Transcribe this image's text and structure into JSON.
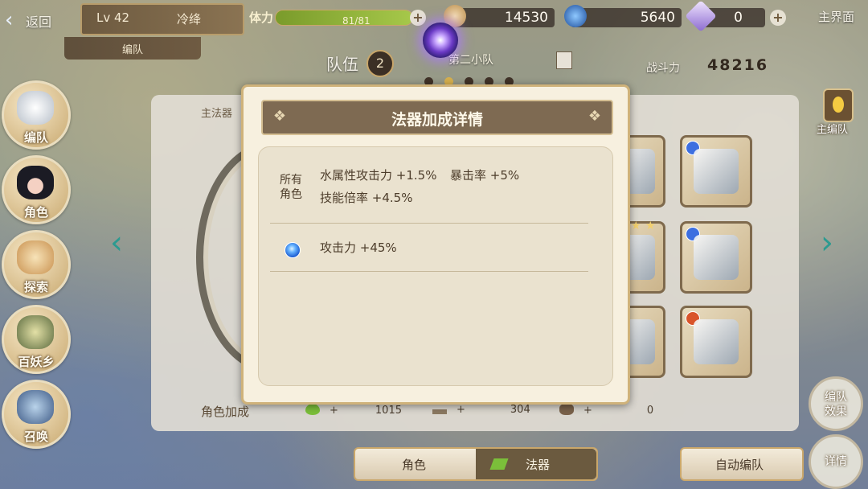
{
  "topbar": {
    "back_label": "返回",
    "level": "Lv 42",
    "player_name": "冷绛",
    "team_label": "编队",
    "stamina_label": "体力",
    "stamina_value": "81/81",
    "stamina_fraction": 1.0,
    "currency1": "14530",
    "currency2": "5640",
    "currency3": "0",
    "main_screen_label": "主界面"
  },
  "formation": {
    "label": "队伍",
    "number": "2",
    "squad_name": "第二小队",
    "page_count": 5,
    "active_page": 1
  },
  "power": {
    "label": "战斗力",
    "value": "48216"
  },
  "leftnav": [
    {
      "label": "编队",
      "icon": "team-icon"
    },
    {
      "label": "角色",
      "icon": "character-icon"
    },
    {
      "label": "探索",
      "icon": "explore-icon"
    },
    {
      "label": "百妖乡",
      "icon": "village-icon"
    },
    {
      "label": "召唤",
      "icon": "summon-icon"
    }
  ],
  "main": {
    "main_artifact_tag": "主法器",
    "role_bonus_label": "角色加成",
    "stat_hp": "1015",
    "stat_atk": "304",
    "stat_spd": "0",
    "stat_plus": "+"
  },
  "bottom": {
    "tab_character": "角色",
    "tab_artifact": "法器",
    "auto_team": "自动编队"
  },
  "right": {
    "main_team": "主编队",
    "team_effect": "编队效果",
    "detail": "详情"
  },
  "modal": {
    "title": "法器加成详情",
    "category_all": "所有角色",
    "bonus1": "水属性攻击力 +1.5%",
    "bonus2": "暴击率 +5%",
    "bonus3": "技能倍率 +4.5%",
    "bonus4": "攻击力 +45%"
  },
  "colors": {
    "accent": "#cfb27a",
    "title_bg": "#7e6a52",
    "modal_bg": "#f7f0df",
    "water": "#1f5fd2"
  }
}
